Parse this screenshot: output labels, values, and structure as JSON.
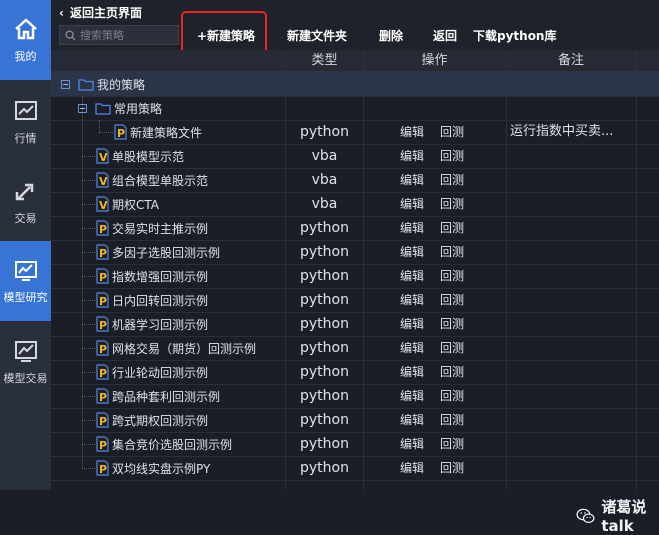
{
  "sidebar": {
    "items": [
      {
        "label": "我的",
        "icon": "home-icon",
        "active": true
      },
      {
        "label": "行情",
        "icon": "chart-icon",
        "active": false
      },
      {
        "label": "交易",
        "icon": "transfer-icon",
        "active": false
      },
      {
        "label": "模型研究",
        "icon": "model-research-icon",
        "active": true
      },
      {
        "label": "模型交易",
        "icon": "model-trade-icon",
        "active": false
      }
    ]
  },
  "topbar": {
    "back_label": "返回主页界面",
    "search_placeholder": "搜索策略",
    "buttons": {
      "new_strategy": "+新建策略",
      "new_folder": "新建文件夹",
      "delete": "删除",
      "back": "返回",
      "download": "下载python库"
    }
  },
  "table": {
    "headers": {
      "type": "类型",
      "actions": "操作",
      "note": "备注"
    },
    "folders": {
      "root": "我的策略",
      "common": "常用策略"
    },
    "edit_label": "编辑",
    "backtest_label": "回测",
    "rows": [
      {
        "name": "新建策略文件",
        "type": "python",
        "icon": "P",
        "note": "运行指数中买卖..."
      },
      {
        "name": "单股模型示范",
        "type": "vba",
        "icon": "V",
        "note": ""
      },
      {
        "name": "组合模型单股示范",
        "type": "vba",
        "icon": "V",
        "note": ""
      },
      {
        "name": "期权CTA",
        "type": "vba",
        "icon": "V",
        "note": ""
      },
      {
        "name": "交易实时主推示例",
        "type": "python",
        "icon": "P",
        "note": ""
      },
      {
        "name": "多因子选股回测示例",
        "type": "python",
        "icon": "P",
        "note": ""
      },
      {
        "name": "指数增强回测示例",
        "type": "python",
        "icon": "P",
        "note": ""
      },
      {
        "name": "日内回转回测示例",
        "type": "python",
        "icon": "P",
        "note": ""
      },
      {
        "name": "机器学习回测示例",
        "type": "python",
        "icon": "P",
        "note": ""
      },
      {
        "name": "网格交易（期货）回测示例",
        "type": "python",
        "icon": "P",
        "note": ""
      },
      {
        "name": "行业轮动回测示例",
        "type": "python",
        "icon": "P",
        "note": ""
      },
      {
        "name": "跨品种套利回测示例",
        "type": "python",
        "icon": "P",
        "note": ""
      },
      {
        "name": "跨式期权回测示例",
        "type": "python",
        "icon": "P",
        "note": ""
      },
      {
        "name": "集合竞价选股回测示例",
        "type": "python",
        "icon": "P",
        "note": ""
      },
      {
        "name": "双均线实盘示例PY",
        "type": "python",
        "icon": "P",
        "note": ""
      }
    ]
  },
  "watermark": {
    "text": "诸葛说talk",
    "icon": "wechat-icon"
  },
  "colors": {
    "accent": "#3774d6",
    "highlight": "#e8262a",
    "python_icon": "#f0b429"
  }
}
